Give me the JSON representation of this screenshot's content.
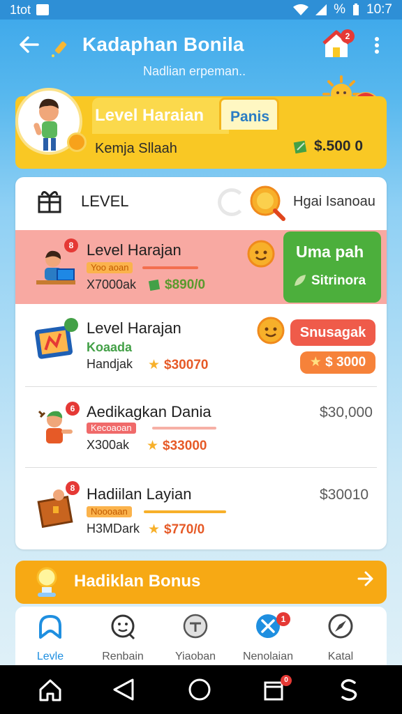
{
  "status_bar": {
    "left_text": "1tot",
    "right_text": "10:7",
    "percent_text": "%"
  },
  "app_bar": {
    "title": "Kadaphan Bonila",
    "subtitle": "Nadlian erpeman.."
  },
  "app_badge_count": "2",
  "level_banner": {
    "title": "Level Haraian",
    "tab_label": "Panis",
    "name": "Kemja Sllaah",
    "amount": "$.500 0"
  },
  "card_header": {
    "label": "LEVEL",
    "right_text": "Hgai Isanoau"
  },
  "rows": [
    {
      "title": "Level Harajan",
      "tag": "Yoo aoan",
      "meta": "X7000ak",
      "price": "$890/0",
      "badge": "8",
      "action_title": "Uma pah",
      "action_sub": "Sitrinora"
    },
    {
      "title": "Level Harajan",
      "green_label": "Koaada",
      "meta": "Handjak",
      "price": "$30070",
      "action_label": "Snusagak",
      "action_price": "$ 3000"
    },
    {
      "title": "Aedikagkan Dania",
      "tag": "Kecoaoan",
      "meta": "X300ak",
      "price": "$33000",
      "right_amount": "$30,000",
      "badge": "6"
    },
    {
      "title": "Hadiilan Layian",
      "tag": "Noooaan",
      "meta": "H3MDark",
      "price": "$770/0",
      "right_amount": "$30010",
      "badge": "8"
    }
  ],
  "bonus": {
    "label": "Hadiklan Bonus"
  },
  "nav": [
    {
      "label": "Levle",
      "icon": "arch-icon",
      "active": true
    },
    {
      "label": "Renbain",
      "icon": "smile-face-icon"
    },
    {
      "label": "Yiaoban",
      "icon": "chat-icon"
    },
    {
      "label": "Nenolaian",
      "icon": "tools-icon",
      "badge": "1"
    },
    {
      "label": "Katal",
      "icon": "compass-icon"
    }
  ],
  "system_nav_badge": "0",
  "colors": {
    "accent_blue": "#2e8fd6",
    "banner_yellow": "#f9c824",
    "highlight_row": "#f8a9a2",
    "green_button": "#4caf3c",
    "red_button": "#ef5b4a",
    "orange_button": "#f6823a",
    "bonus_orange": "#f7a914"
  }
}
